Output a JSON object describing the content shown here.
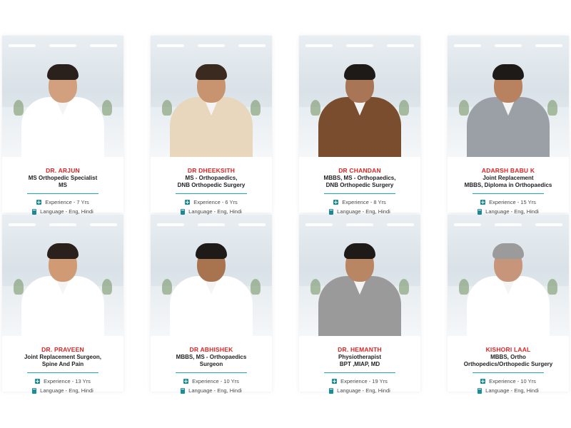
{
  "cards": [
    {
      "name": "DR. ARJUN",
      "qual": [
        "MS Orthopedic Specialist",
        "MS"
      ],
      "experience": "Experience - 7 Yrs",
      "language": "Language - Eng, Hindi",
      "suit": "#ffffff",
      "hair": "#2a211d",
      "skin": "#d2a07e"
    },
    {
      "name": "DR DHEEKSITH",
      "qual": [
        "MS - Orthopaedics,",
        "DNB Orthopedic Surgery"
      ],
      "experience": "Experience - 6 Yrs",
      "language": "Language - Eng, Hindi",
      "suit": "#e8d7bd",
      "hair": "#3a2a1f",
      "skin": "#c8946f"
    },
    {
      "name": "DR CHANDAN",
      "qual": [
        "MBBS, MS - Orthopaedics,",
        "DNB Orthopedic Surgery"
      ],
      "experience": "Experience - 8 Yrs",
      "language": "Language - Eng, Hindi",
      "suit": "#7a4d2f",
      "hair": "#1e1a18",
      "skin": "#a97557"
    },
    {
      "name": "ADARSH BABU K",
      "qual": [
        "Joint Replacement",
        "MBBS, Diploma in Orthopaedics"
      ],
      "experience": "Experience - 15 Yrs",
      "language": "Language - Eng, Hindi",
      "suit": "#9b9fa6",
      "hair": "#1e1a18",
      "skin": "#b88261"
    },
    {
      "name": "DR. PRAVEEN",
      "qual": [
        "Joint Replacement Surgeon,",
        "Spine And Pain"
      ],
      "experience": "Experience - 13 Yrs",
      "language": "Language - Eng, Hindi",
      "suit": "#ffffff",
      "hair": "#2a211d",
      "skin": "#cf9a74"
    },
    {
      "name": "DR ABHISHEK",
      "qual": [
        "MBBS, MS - Orthopaedics",
        "Surgeon"
      ],
      "experience": "Experience - 10 Yrs",
      "language": "Language - Eng, Hindi",
      "suit": "#ffffff",
      "hair": "#1e1a18",
      "skin": "#a8744f"
    },
    {
      "name": "DR. HEMANTH",
      "qual": [
        "Physiotherapist",
        "BPT ,MIAP, MD"
      ],
      "experience": "Experience - 19 Yrs",
      "language": "Language - Eng, Hindi",
      "suit": "#9a9a9a",
      "hair": "#1e1a18",
      "skin": "#b88662"
    },
    {
      "name": "KISHORI LAAL",
      "qual": [
        "MBBS, Ortho",
        "Orthopedics/Orthopedic Surgery"
      ],
      "experience": "Experience - 10 Yrs",
      "language": "Language - Eng, Hindi",
      "suit": "#ffffff",
      "hair": "#9b9b9b",
      "skin": "#c6957a"
    }
  ]
}
